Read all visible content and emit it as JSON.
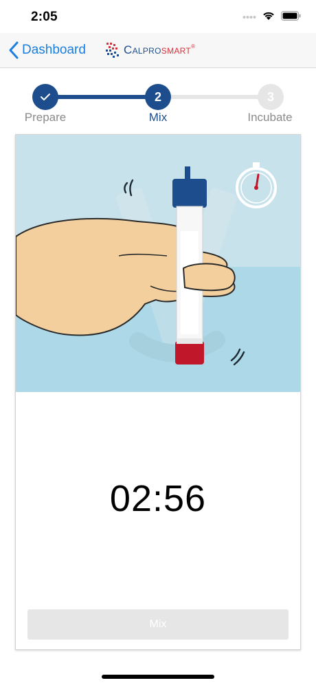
{
  "status_bar": {
    "time": "2:05"
  },
  "nav": {
    "back_label": "Dashboard",
    "brand_part1": "Calpro",
    "brand_part2": "smart",
    "brand_reg": "®"
  },
  "stepper": {
    "steps": [
      {
        "number": "1",
        "label": "Prepare",
        "state": "completed"
      },
      {
        "number": "2",
        "label": "Mix",
        "state": "active"
      },
      {
        "number": "3",
        "label": "Incubate",
        "state": "upcoming"
      }
    ]
  },
  "timer": {
    "value": "02:56"
  },
  "actions": {
    "mix_label": "Mix"
  },
  "icons": {
    "back": "chevron-left-icon",
    "completed_step": "checkmark-icon",
    "stopwatch": "stopwatch-icon"
  },
  "colors": {
    "accent_blue": "#1a7fe0",
    "step_active": "#1d4d8c",
    "step_inactive": "#e6e6e6",
    "brand_blue": "#1d4d8c",
    "brand_red": "#d6303a",
    "illustration_sky": "#c8e2ec",
    "illustration_water": "#acd8e8"
  }
}
